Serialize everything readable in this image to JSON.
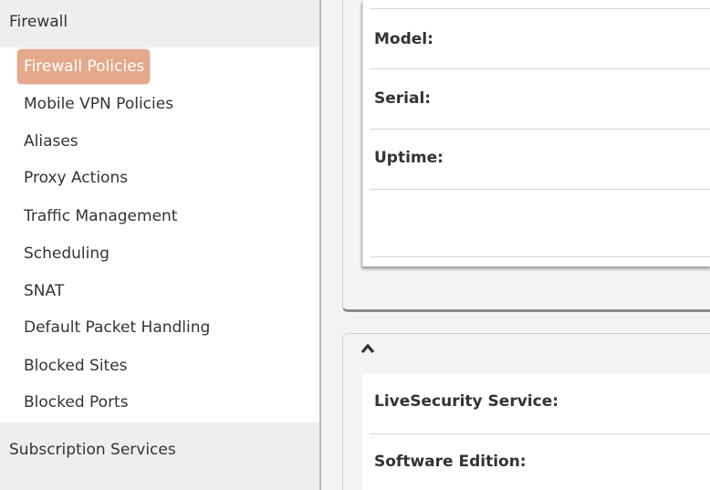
{
  "sidebar": {
    "section_firewall": "Firewall",
    "items": [
      {
        "label": "Firewall Policies"
      },
      {
        "label": "Mobile VPN Policies"
      },
      {
        "label": "Aliases"
      },
      {
        "label": "Proxy Actions"
      },
      {
        "label": "Traffic Management"
      },
      {
        "label": "Scheduling"
      },
      {
        "label": "SNAT"
      },
      {
        "label": "Default Packet Handling"
      },
      {
        "label": "Blocked Sites"
      },
      {
        "label": "Blocked Ports"
      }
    ],
    "section_subscription": "Subscription Services",
    "active_item": "Firewall Policies"
  },
  "device_info": {
    "model_label": "Model:",
    "serial_label": "Serial:",
    "uptime_label": "Uptime:"
  },
  "license_panel": {
    "collapse_icon": "chevron-up-icon",
    "livesecurity_label": "LiveSecurity Service:",
    "software_edition_label": "Software Edition:"
  },
  "colors": {
    "active_item_bg": "#e3a98a",
    "section_header_bg": "#eeeeee"
  }
}
